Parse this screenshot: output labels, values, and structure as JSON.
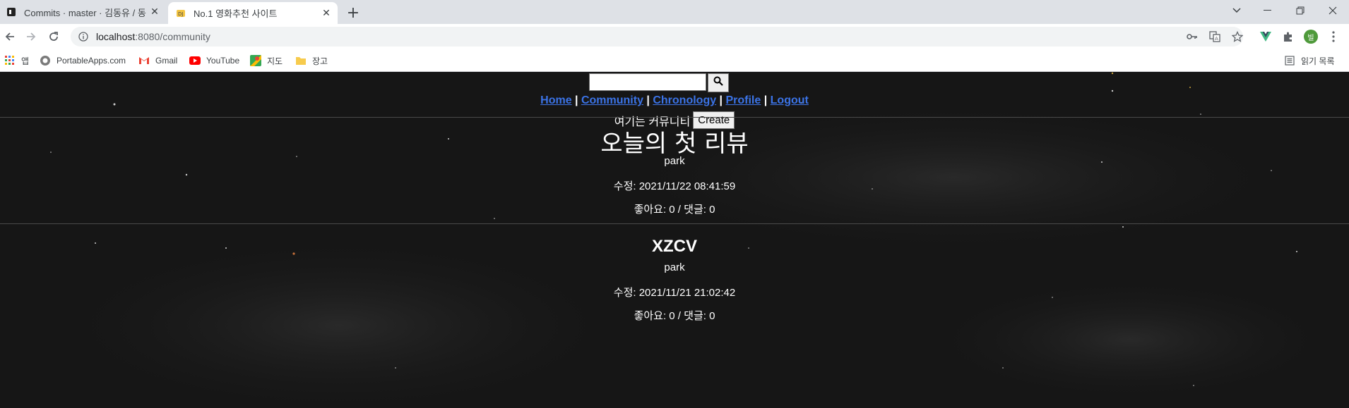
{
  "browser": {
    "tabs": [
      {
        "title": "Commits · master · 김동유 / 동",
        "active": false
      },
      {
        "title": "No.1 영화추천 사이트",
        "active": true
      }
    ],
    "new_tab_label": "+",
    "url_host": "localhost",
    "url_path": ":8080/community",
    "bookmarks": [
      {
        "label": "앱",
        "icon": "apps-grid-icon"
      },
      {
        "label": "PortableApps.com",
        "icon": "portableapps-icon"
      },
      {
        "label": "Gmail",
        "icon": "gmail-icon"
      },
      {
        "label": "YouTube",
        "icon": "youtube-icon"
      },
      {
        "label": "지도",
        "icon": "maps-icon"
      },
      {
        "label": "장고",
        "icon": "folder-icon"
      }
    ],
    "reading_list_label": "읽기 목록",
    "profile_initial": "빌"
  },
  "page": {
    "search": {
      "value": "",
      "placeholder": ""
    },
    "nav": {
      "home": "Home",
      "community": "Community",
      "chronology": "Chronology",
      "profile": "Profile",
      "logout": "Logout",
      "separator": " | "
    },
    "intro_text": "여기는 커뮤니티",
    "create_label": "Create",
    "posts": [
      {
        "title": "오늘의 첫 리뷰",
        "author": "park",
        "modified": "수정: 2021/11/22 08:41:59",
        "stats": "좋아요: 0 / 댓글: 0"
      },
      {
        "title": "XZCV",
        "author": "park",
        "modified": "수정: 2021/11/21 21:02:42",
        "stats": "좋아요: 0 / 댓글: 0"
      }
    ]
  },
  "colors": {
    "page_bg": "#161616",
    "link": "#3b73e6",
    "tabstrip": "#dee1e6"
  }
}
